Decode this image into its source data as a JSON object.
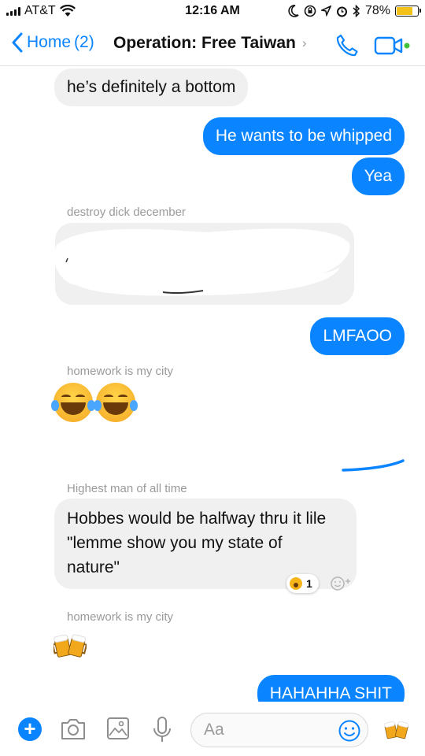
{
  "status_bar": {
    "carrier": "AT&T",
    "time": "12:16 AM",
    "battery_percent": "78%",
    "battery_level": 0.78
  },
  "nav": {
    "back_label": "Home",
    "unread_count": "(2)",
    "title": "Operation: Free Taiwan",
    "chevron": "›",
    "accent_color": "#0a84ff"
  },
  "messages": {
    "m1": "he’s definitely a bottom",
    "m2": "He wants to be whipped",
    "m3": "Yea",
    "sender_destroy": "destroy dick december",
    "m4": "LMFAOO",
    "sender_homework_1": "homework is my city",
    "sender_highest": "Highest man of all time",
    "hobbes_line1": "Hobbes would be halfway thru it lile",
    "hobbes_line2": "\"lemme show you my state of",
    "hobbes_line3": "nature\"",
    "reaction_count": "1",
    "sender_homework_2": "homework is my city",
    "m_last": "HAHAHHA SHIT",
    "incoming_bubble_color": "#f0f0f0",
    "outgoing_bubble_color": "#0a84ff"
  },
  "composer": {
    "plus_label": "+",
    "placeholder": "Aa"
  },
  "icons": [
    "signal-icon",
    "wifi-icon",
    "moon-icon",
    "lock-rotation-icon",
    "location-icon",
    "alarm-icon",
    "bluetooth-icon",
    "battery-icon",
    "back-chevron-icon",
    "phone-icon",
    "video-icon",
    "laughing-emoji",
    "beer-mugs-emoji",
    "camera-icon",
    "image-icon",
    "microphone-icon",
    "smile-icon",
    "add-reaction-icon"
  ]
}
